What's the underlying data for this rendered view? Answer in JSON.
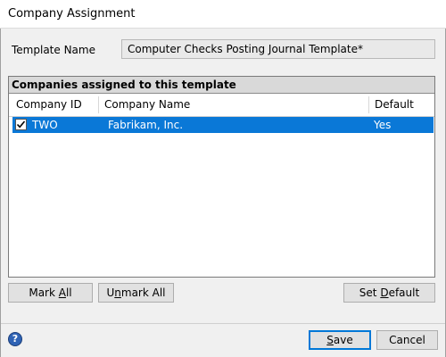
{
  "window": {
    "title": "Company Assignment"
  },
  "template_name": {
    "label": "Template Name",
    "value": "Computer Checks Posting Journal Template*"
  },
  "companies_group": {
    "header": "Companies assigned to this template",
    "columns": [
      "Company ID",
      "Company Name",
      "Default"
    ],
    "rows": [
      {
        "checked": true,
        "company_id": "TWO",
        "company_name": "Fabrikam, Inc.",
        "default": "Yes",
        "selected": true
      }
    ]
  },
  "buttons": {
    "mark_all": {
      "pre": "Mark ",
      "mnemonic": "A",
      "post": "ll"
    },
    "unmark_all": {
      "pre": "U",
      "mnemonic": "n",
      "post": "mark All"
    },
    "set_default": {
      "pre": "Set ",
      "mnemonic": "D",
      "post": "efault"
    },
    "save": {
      "pre": "",
      "mnemonic": "S",
      "post": "ave"
    },
    "cancel": {
      "pre": "",
      "mnemonic": "",
      "post": "Cancel"
    }
  },
  "icons": {
    "help": "help-icon",
    "check": "checkmark-icon"
  },
  "colors": {
    "selection": "#0a78d7",
    "accent": "#0078d7",
    "group_header_bg": "#d9d9d9"
  }
}
